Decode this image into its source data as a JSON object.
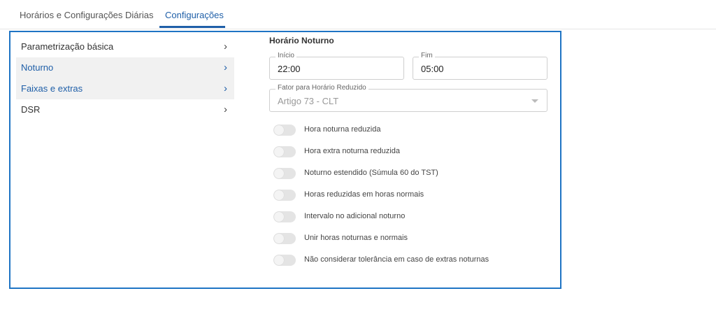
{
  "tabs": [
    {
      "label": "Horários e Configurações Diárias"
    },
    {
      "label": "Configurações"
    }
  ],
  "sidebar": {
    "items": [
      {
        "label": "Parametrização básica"
      },
      {
        "label": "Noturno"
      },
      {
        "label": "Faixas e extras"
      },
      {
        "label": "DSR"
      }
    ],
    "chevron": "›"
  },
  "panel": {
    "title": "Horário Noturno",
    "inicio": {
      "label": "Início",
      "value": "22:00"
    },
    "fim": {
      "label": "Fim",
      "value": "05:00"
    },
    "fator": {
      "label": "Fator para Horário Reduzido",
      "value": "Artigo 73 - CLT"
    },
    "toggles": [
      {
        "label": "Hora noturna reduzida",
        "on": false
      },
      {
        "label": "Hora extra noturna reduzida",
        "on": false
      },
      {
        "label": "Noturno estendido (Súmula 60 do TST)",
        "on": false
      },
      {
        "label": "Horas reduzidas em horas normais",
        "on": false
      },
      {
        "label": "Intervalo no adicional noturno",
        "on": false
      },
      {
        "label": "Unir horas noturnas e normais",
        "on": false
      },
      {
        "label": "Não considerar tolerância em caso de extras noturnas",
        "on": false
      }
    ]
  },
  "colors": {
    "accent": "#1f5fa8",
    "frame": "#1e74c4"
  }
}
